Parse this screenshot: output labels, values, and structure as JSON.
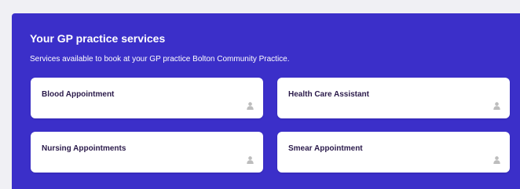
{
  "services_panel": {
    "title": "Your GP practice services",
    "subtitle": "Services available to book at your GP practice Bolton Community Practice.",
    "background_color": "#3b2fc9",
    "services": [
      {
        "label": "Blood Appointment",
        "icon": "person-icon"
      },
      {
        "label": "Health Care Assistant",
        "icon": "person-icon"
      },
      {
        "label": "Nursing Appointments",
        "icon": "person-icon"
      },
      {
        "label": "Smear Appointment",
        "icon": "person-icon"
      }
    ]
  }
}
